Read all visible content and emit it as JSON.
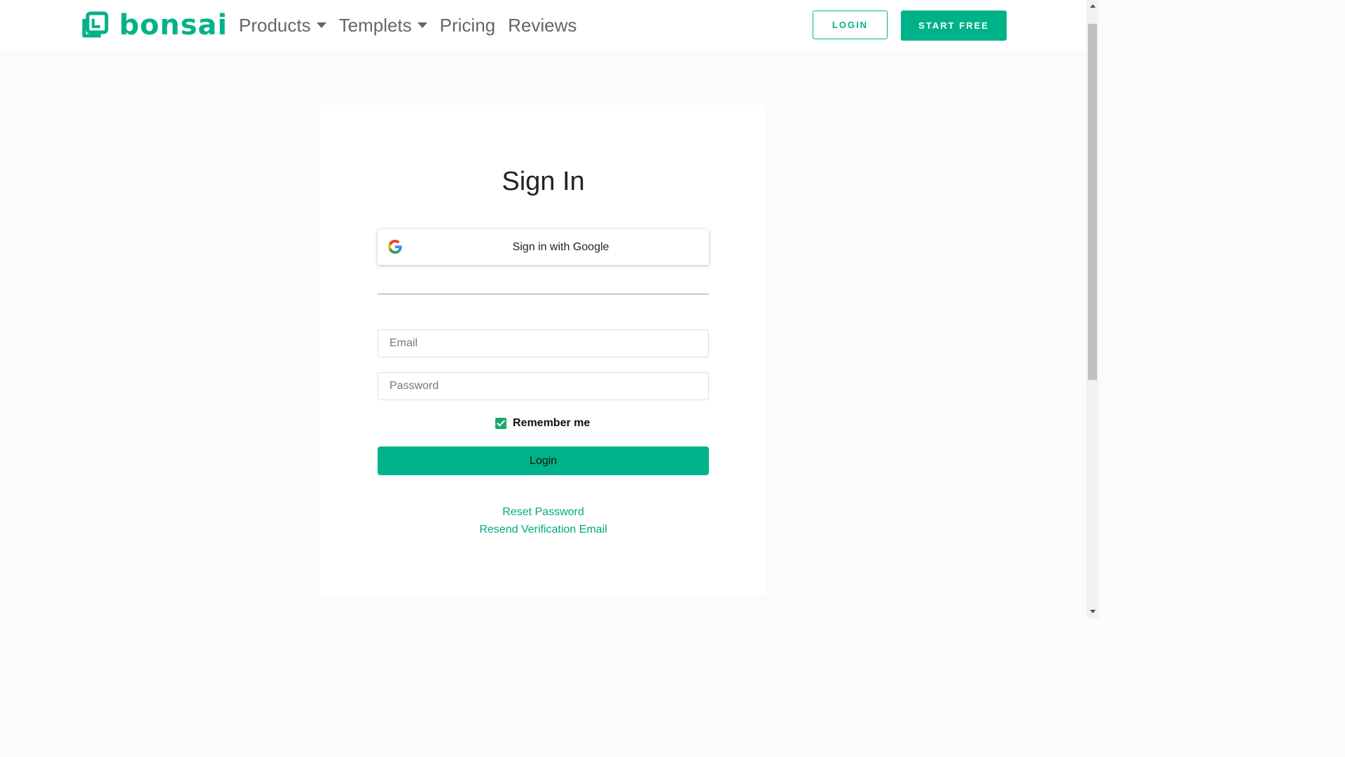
{
  "header": {
    "logo_text": "bonsai",
    "nav": [
      {
        "label": "Products",
        "has_dropdown": true
      },
      {
        "label": "Templets",
        "has_dropdown": true
      },
      {
        "label": "Pricing",
        "has_dropdown": false
      },
      {
        "label": "Reviews",
        "has_dropdown": false
      }
    ],
    "login_label": "LOGIN",
    "start_free_label": "START FREE"
  },
  "signin": {
    "title": "Sign In",
    "google_label": "Sign in with Google",
    "email_placeholder": "Email",
    "password_placeholder": "Password",
    "remember_label": "Remember me",
    "remember_checked": true,
    "submit_label": "Login",
    "reset_password_link": "Reset Password",
    "resend_verification_link": "Resend Verification Email"
  },
  "colors": {
    "accent": "#00b289",
    "link": "#00a885",
    "checkbox": "#1aa870"
  },
  "icons": {
    "logo": "bonsai-logo-icon",
    "google": "google-icon",
    "dropdown": "caret-down-icon"
  }
}
